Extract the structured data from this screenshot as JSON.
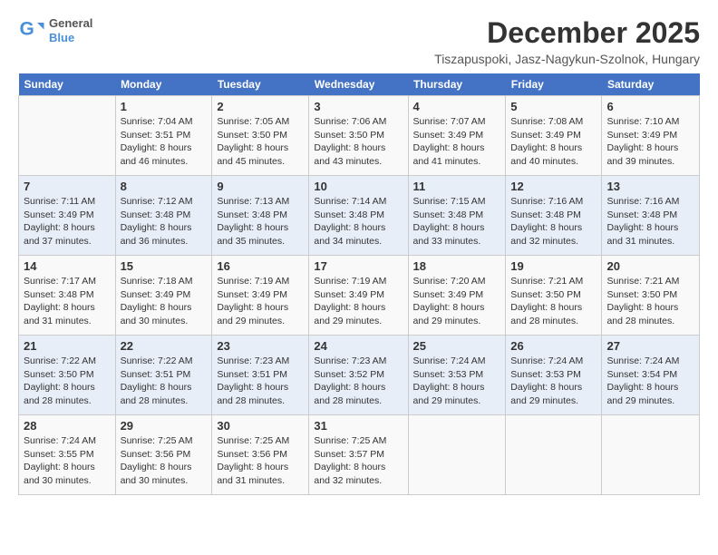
{
  "logo": {
    "general": "General",
    "blue": "Blue"
  },
  "title": "December 2025",
  "location": "Tiszapuspoki, Jasz-Nagykun-Szolnok, Hungary",
  "days_of_week": [
    "Sunday",
    "Monday",
    "Tuesday",
    "Wednesday",
    "Thursday",
    "Friday",
    "Saturday"
  ],
  "weeks": [
    [
      {
        "day": "",
        "sunrise": "",
        "sunset": "",
        "daylight": ""
      },
      {
        "day": "1",
        "sunrise": "Sunrise: 7:04 AM",
        "sunset": "Sunset: 3:51 PM",
        "daylight": "Daylight: 8 hours and 46 minutes."
      },
      {
        "day": "2",
        "sunrise": "Sunrise: 7:05 AM",
        "sunset": "Sunset: 3:50 PM",
        "daylight": "Daylight: 8 hours and 45 minutes."
      },
      {
        "day": "3",
        "sunrise": "Sunrise: 7:06 AM",
        "sunset": "Sunset: 3:50 PM",
        "daylight": "Daylight: 8 hours and 43 minutes."
      },
      {
        "day": "4",
        "sunrise": "Sunrise: 7:07 AM",
        "sunset": "Sunset: 3:49 PM",
        "daylight": "Daylight: 8 hours and 41 minutes."
      },
      {
        "day": "5",
        "sunrise": "Sunrise: 7:08 AM",
        "sunset": "Sunset: 3:49 PM",
        "daylight": "Daylight: 8 hours and 40 minutes."
      },
      {
        "day": "6",
        "sunrise": "Sunrise: 7:10 AM",
        "sunset": "Sunset: 3:49 PM",
        "daylight": "Daylight: 8 hours and 39 minutes."
      }
    ],
    [
      {
        "day": "7",
        "sunrise": "Sunrise: 7:11 AM",
        "sunset": "Sunset: 3:49 PM",
        "daylight": "Daylight: 8 hours and 37 minutes."
      },
      {
        "day": "8",
        "sunrise": "Sunrise: 7:12 AM",
        "sunset": "Sunset: 3:48 PM",
        "daylight": "Daylight: 8 hours and 36 minutes."
      },
      {
        "day": "9",
        "sunrise": "Sunrise: 7:13 AM",
        "sunset": "Sunset: 3:48 PM",
        "daylight": "Daylight: 8 hours and 35 minutes."
      },
      {
        "day": "10",
        "sunrise": "Sunrise: 7:14 AM",
        "sunset": "Sunset: 3:48 PM",
        "daylight": "Daylight: 8 hours and 34 minutes."
      },
      {
        "day": "11",
        "sunrise": "Sunrise: 7:15 AM",
        "sunset": "Sunset: 3:48 PM",
        "daylight": "Daylight: 8 hours and 33 minutes."
      },
      {
        "day": "12",
        "sunrise": "Sunrise: 7:16 AM",
        "sunset": "Sunset: 3:48 PM",
        "daylight": "Daylight: 8 hours and 32 minutes."
      },
      {
        "day": "13",
        "sunrise": "Sunrise: 7:16 AM",
        "sunset": "Sunset: 3:48 PM",
        "daylight": "Daylight: 8 hours and 31 minutes."
      }
    ],
    [
      {
        "day": "14",
        "sunrise": "Sunrise: 7:17 AM",
        "sunset": "Sunset: 3:48 PM",
        "daylight": "Daylight: 8 hours and 31 minutes."
      },
      {
        "day": "15",
        "sunrise": "Sunrise: 7:18 AM",
        "sunset": "Sunset: 3:49 PM",
        "daylight": "Daylight: 8 hours and 30 minutes."
      },
      {
        "day": "16",
        "sunrise": "Sunrise: 7:19 AM",
        "sunset": "Sunset: 3:49 PM",
        "daylight": "Daylight: 8 hours and 29 minutes."
      },
      {
        "day": "17",
        "sunrise": "Sunrise: 7:19 AM",
        "sunset": "Sunset: 3:49 PM",
        "daylight": "Daylight: 8 hours and 29 minutes."
      },
      {
        "day": "18",
        "sunrise": "Sunrise: 7:20 AM",
        "sunset": "Sunset: 3:49 PM",
        "daylight": "Daylight: 8 hours and 29 minutes."
      },
      {
        "day": "19",
        "sunrise": "Sunrise: 7:21 AM",
        "sunset": "Sunset: 3:50 PM",
        "daylight": "Daylight: 8 hours and 28 minutes."
      },
      {
        "day": "20",
        "sunrise": "Sunrise: 7:21 AM",
        "sunset": "Sunset: 3:50 PM",
        "daylight": "Daylight: 8 hours and 28 minutes."
      }
    ],
    [
      {
        "day": "21",
        "sunrise": "Sunrise: 7:22 AM",
        "sunset": "Sunset: 3:50 PM",
        "daylight": "Daylight: 8 hours and 28 minutes."
      },
      {
        "day": "22",
        "sunrise": "Sunrise: 7:22 AM",
        "sunset": "Sunset: 3:51 PM",
        "daylight": "Daylight: 8 hours and 28 minutes."
      },
      {
        "day": "23",
        "sunrise": "Sunrise: 7:23 AM",
        "sunset": "Sunset: 3:51 PM",
        "daylight": "Daylight: 8 hours and 28 minutes."
      },
      {
        "day": "24",
        "sunrise": "Sunrise: 7:23 AM",
        "sunset": "Sunset: 3:52 PM",
        "daylight": "Daylight: 8 hours and 28 minutes."
      },
      {
        "day": "25",
        "sunrise": "Sunrise: 7:24 AM",
        "sunset": "Sunset: 3:53 PM",
        "daylight": "Daylight: 8 hours and 29 minutes."
      },
      {
        "day": "26",
        "sunrise": "Sunrise: 7:24 AM",
        "sunset": "Sunset: 3:53 PM",
        "daylight": "Daylight: 8 hours and 29 minutes."
      },
      {
        "day": "27",
        "sunrise": "Sunrise: 7:24 AM",
        "sunset": "Sunset: 3:54 PM",
        "daylight": "Daylight: 8 hours and 29 minutes."
      }
    ],
    [
      {
        "day": "28",
        "sunrise": "Sunrise: 7:24 AM",
        "sunset": "Sunset: 3:55 PM",
        "daylight": "Daylight: 8 hours and 30 minutes."
      },
      {
        "day": "29",
        "sunrise": "Sunrise: 7:25 AM",
        "sunset": "Sunset: 3:56 PM",
        "daylight": "Daylight: 8 hours and 30 minutes."
      },
      {
        "day": "30",
        "sunrise": "Sunrise: 7:25 AM",
        "sunset": "Sunset: 3:56 PM",
        "daylight": "Daylight: 8 hours and 31 minutes."
      },
      {
        "day": "31",
        "sunrise": "Sunrise: 7:25 AM",
        "sunset": "Sunset: 3:57 PM",
        "daylight": "Daylight: 8 hours and 32 minutes."
      },
      {
        "day": "",
        "sunrise": "",
        "sunset": "",
        "daylight": ""
      },
      {
        "day": "",
        "sunrise": "",
        "sunset": "",
        "daylight": ""
      },
      {
        "day": "",
        "sunrise": "",
        "sunset": "",
        "daylight": ""
      }
    ]
  ]
}
